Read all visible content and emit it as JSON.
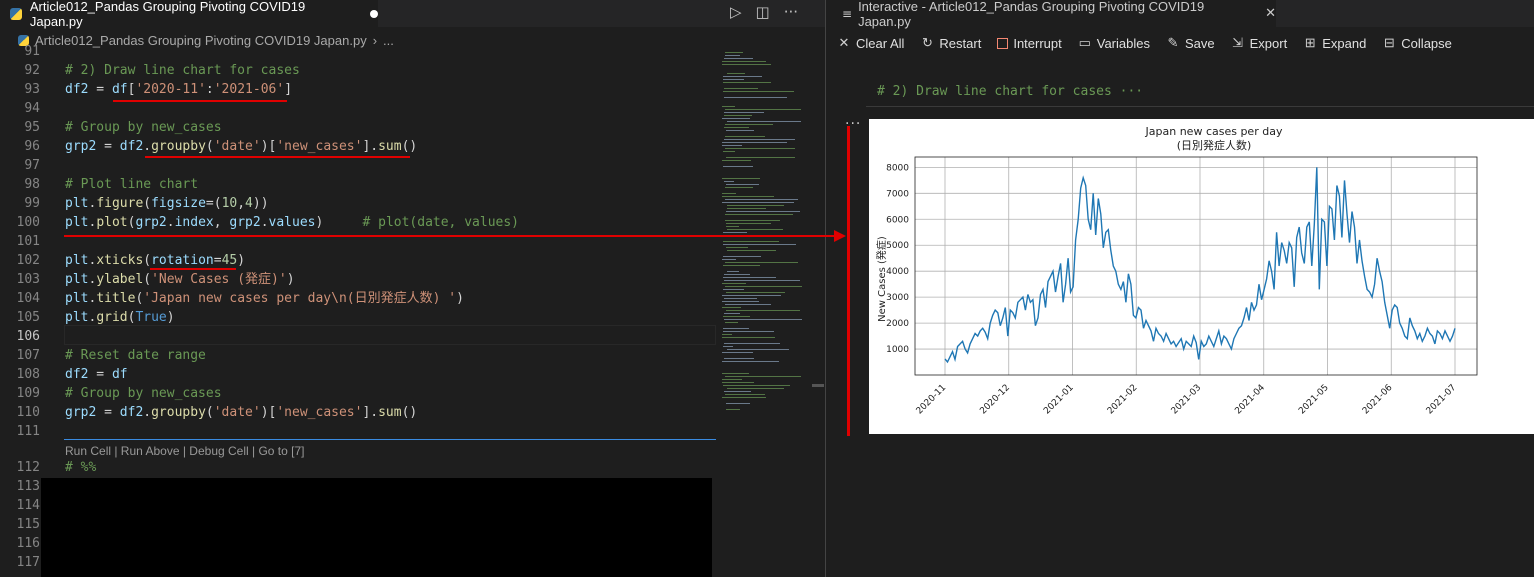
{
  "left_tab": {
    "title": "Article012_Pandas Grouping Pivoting COVID19 Japan.py"
  },
  "breadcrumb": {
    "file": "Article012_Pandas Grouping Pivoting COVID19 Japan.py",
    "more": "..."
  },
  "editor_actions": {
    "run": "▷",
    "split": "◫",
    "more": "···"
  },
  "code_lines": [
    {
      "n": "91",
      "html": ""
    },
    {
      "n": "92",
      "html": "<span class='c-com'># 2) Draw line chart for cases</span>"
    },
    {
      "n": "93",
      "html": "<span class='c-var'>df2</span><span class='c-pl'> = </span><span class='c-var'>df</span><span class='c-pl'>[</span><span class='c-str'>'2020-11'</span><span class='c-pl'>:</span><span class='c-str'>'2021-06'</span><span class='c-pl'>]</span>"
    },
    {
      "n": "94",
      "html": ""
    },
    {
      "n": "95",
      "html": "<span class='c-com'># Group by new_cases</span>"
    },
    {
      "n": "96",
      "html": "<span class='c-var'>grp2</span><span class='c-pl'> = </span><span class='c-var'>df2</span><span class='c-pl'>.</span><span class='c-fn'>groupby</span><span class='c-pl'>(</span><span class='c-str'>'date'</span><span class='c-pl'>)[</span><span class='c-str'>'new_cases'</span><span class='c-pl'>].</span><span class='c-fn'>sum</span><span class='c-pl'>()</span>"
    },
    {
      "n": "97",
      "html": ""
    },
    {
      "n": "98",
      "html": "<span class='c-com'># Plot line chart</span>"
    },
    {
      "n": "99",
      "html": "<span class='c-var'>plt</span><span class='c-pl'>.</span><span class='c-fn'>figure</span><span class='c-pl'>(</span><span class='c-var'>figsize</span><span class='c-pl'>=(</span><span class='c-num'>10</span><span class='c-pl'>,</span><span class='c-num'>4</span><span class='c-pl'>))</span>"
    },
    {
      "n": "100",
      "html": "<span class='c-var'>plt</span><span class='c-pl'>.</span><span class='c-fn'>plot</span><span class='c-pl'>(</span><span class='c-var'>grp2</span><span class='c-pl'>.</span><span class='c-var'>index</span><span class='c-pl'>, </span><span class='c-var'>grp2</span><span class='c-pl'>.</span><span class='c-var'>values</span><span class='c-pl'>)     </span><span class='c-com'># plot(date, values)</span>"
    },
    {
      "n": "101",
      "html": ""
    },
    {
      "n": "102",
      "html": "<span class='c-var'>plt</span><span class='c-pl'>.</span><span class='c-fn'>xticks</span><span class='c-pl'>(</span><span class='c-var'>rotation</span><span class='c-pl'>=</span><span class='c-num'>45</span><span class='c-pl'>)</span>"
    },
    {
      "n": "103",
      "html": "<span class='c-var'>plt</span><span class='c-pl'>.</span><span class='c-fn'>ylabel</span><span class='c-pl'>(</span><span class='c-str'>'New Cases (発症)'</span><span class='c-pl'>)</span>"
    },
    {
      "n": "104",
      "html": "<span class='c-var'>plt</span><span class='c-pl'>.</span><span class='c-fn'>title</span><span class='c-pl'>(</span><span class='c-str'>'Japan new cases per day\\n(日別発症人数) '</span><span class='c-pl'>)</span>"
    },
    {
      "n": "105",
      "html": "<span class='c-var'>plt</span><span class='c-pl'>.</span><span class='c-fn'>grid</span><span class='c-pl'>(</span><span class='c-kw'>True</span><span class='c-pl'>)</span>"
    },
    {
      "n": "106",
      "html": ""
    },
    {
      "n": "107",
      "html": "<span class='c-com'># Reset date range</span>"
    },
    {
      "n": "108",
      "html": "<span class='c-var'>df2</span><span class='c-pl'> = </span><span class='c-var'>df</span>"
    },
    {
      "n": "109",
      "html": "<span class='c-com'># Group by new_cases</span>"
    },
    {
      "n": "110",
      "html": "<span class='c-var'>grp2</span><span class='c-pl'> = </span><span class='c-var'>df2</span><span class='c-pl'>.</span><span class='c-fn'>groupby</span><span class='c-pl'>(</span><span class='c-str'>'date'</span><span class='c-pl'>)[</span><span class='c-str'>'new_cases'</span><span class='c-pl'>].</span><span class='c-fn'>sum</span><span class='c-pl'>()</span>"
    },
    {
      "n": "111",
      "html": ""
    },
    {
      "n": "112",
      "html": "<span class='c-com'># %%</span>"
    },
    {
      "n": "113",
      "html": ""
    },
    {
      "n": "114",
      "html": ""
    },
    {
      "n": "115",
      "html": ""
    },
    {
      "n": "116",
      "html": ""
    },
    {
      "n": "117",
      "html": ""
    }
  ],
  "codelens": "Run Cell | Run Above | Debug Cell | Go to [7]",
  "right_tab": {
    "title": "Interactive - Article012_Pandas Grouping Pivoting COVID19 Japan.py",
    "close": "✕"
  },
  "toolbar": {
    "clear_all": "Clear All",
    "restart": "Restart",
    "interrupt": "Interrupt",
    "variables": "Variables",
    "save": "Save",
    "export": "Export",
    "expand": "Expand",
    "collapse": "Collapse"
  },
  "cell_header": "# 2) Draw line chart for cases ···",
  "cell_ellipsis": "···",
  "colors": {
    "accent_red": "#e00000",
    "line_blue": "#1f77b4"
  },
  "chart_data": {
    "type": "line",
    "title": "Japan new cases per day",
    "subtitle": "(日別発症人数)",
    "ylabel": "New Cases (発症)",
    "xlabel": "",
    "ylim": [
      0,
      8400
    ],
    "yticks": [
      1000,
      2000,
      3000,
      4000,
      5000,
      6000,
      7000,
      8000
    ],
    "xtick_labels": [
      "2020-11",
      "2020-12",
      "2021-01",
      "2021-02",
      "2021-03",
      "2021-04",
      "2021-05",
      "2021-06",
      "2021-07"
    ],
    "grid": true,
    "x_start": "2020-11-01",
    "x_end": "2021-07-01",
    "series": [
      {
        "values": [
          620,
          500,
          700,
          900,
          600,
          1100,
          1200,
          1300,
          1000,
          850,
          1200,
          1400,
          1600,
          1500,
          1700,
          1800,
          1650,
          1400,
          2000,
          2300,
          2500,
          2400,
          1900,
          2200,
          2600,
          1500,
          2500,
          2400,
          2200,
          2800,
          2900,
          3000,
          2500,
          3100,
          2800,
          2900,
          1900,
          2200,
          3100,
          3300,
          2600,
          3600,
          3800,
          4000,
          3200,
          3800,
          4300,
          2800,
          3500,
          4500,
          3200,
          3400,
          5200,
          6000,
          7200,
          7600,
          7300,
          6000,
          5600,
          7000,
          5400,
          6800,
          6200,
          4900,
          5500,
          5600,
          4800,
          4200,
          4000,
          3500,
          3300,
          3600,
          2800,
          3900,
          3500,
          2300,
          2200,
          2600,
          2500,
          1800,
          2100,
          1900,
          1700,
          1300,
          1800,
          1600,
          1500,
          1300,
          1600,
          1400,
          1200,
          1300,
          1100,
          1250,
          1400,
          1000,
          1300,
          1200,
          1100,
          1500,
          1250,
          600,
          1300,
          1100,
          1200,
          1500,
          1300,
          1100,
          1400,
          1700,
          1200,
          1500,
          1400,
          1200,
          1000,
          1400,
          1600,
          1800,
          1900,
          2200,
          2600,
          2100,
          2800,
          2500,
          2700,
          3500,
          2900,
          3300,
          3700,
          4400,
          4000,
          3300,
          5500,
          4200,
          5100,
          4800,
          4300,
          5100,
          4900,
          3400,
          5300,
          5700,
          4700,
          4300,
          5700,
          5900,
          4200,
          5800,
          8000,
          3300,
          6000,
          5900,
          4200,
          6500,
          6400,
          5200,
          7300,
          6900,
          5300,
          7500,
          6200,
          5100,
          6300,
          5700,
          4300,
          5200,
          4400,
          3800,
          3300,
          3200,
          3000,
          3500,
          4500,
          4000,
          3600,
          2800,
          2300,
          1800,
          2500,
          2700,
          2600,
          2000,
          1800,
          1500,
          1400,
          2200,
          1900,
          1700,
          1400,
          1600,
          1300,
          1500,
          1800,
          1600,
          1500,
          1200,
          1700,
          1600,
          1400,
          1700,
          1500,
          1300,
          1500,
          1800
        ]
      }
    ]
  }
}
